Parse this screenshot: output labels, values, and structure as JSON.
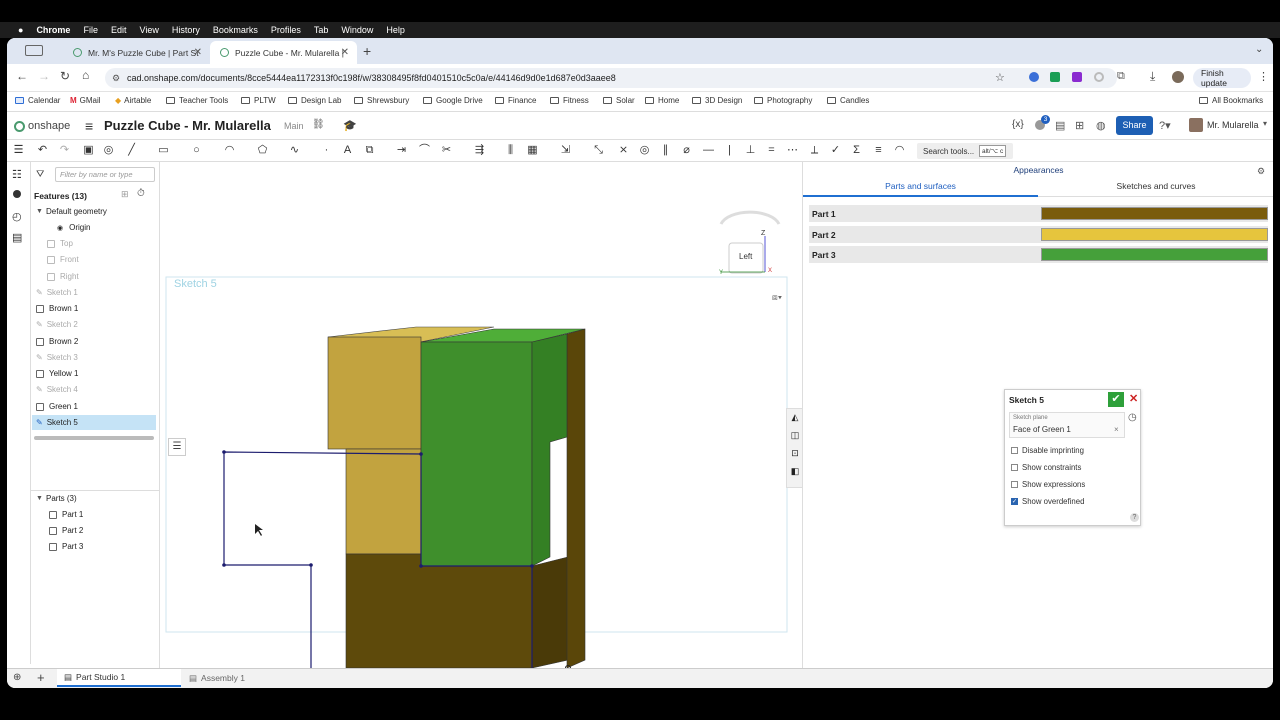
{
  "mac_menu": {
    "apple": "",
    "app": "Chrome",
    "items": [
      "File",
      "Edit",
      "View",
      "History",
      "Bookmarks",
      "Profiles",
      "Tab",
      "Window",
      "Help"
    ]
  },
  "tabs": [
    {
      "title": "Mr. M's Puzzle Cube | Part St"
    },
    {
      "title": "Puzzle Cube - Mr. Mularella |"
    }
  ],
  "address": {
    "url": "cad.onshape.com/documents/8cce5444ea1172313f0c198f/w/38308495f8fd0401510c5c0a/e/44146d9d0e1d687e0d3aaee8",
    "finish_update": "Finish update"
  },
  "bookmarks": [
    "Calendar",
    "GMail",
    "Airtable",
    "Teacher Tools",
    "PLTW",
    "Design Lab",
    "Shrewsbury",
    "Google Drive",
    "Finance",
    "Fitness",
    "Solar",
    "Home",
    "3D Design",
    "Photography",
    "Candles"
  ],
  "all_bookmarks": "All Bookmarks",
  "onshape": {
    "logo": "onshape",
    "doc_title": "Puzzle Cube - Mr. Mularella",
    "branch": "Main",
    "notif_count": "3",
    "share": "Share",
    "user": "Mr. Mularella",
    "search_tools": "Search tools...",
    "shortcut": "alt/⌥ c"
  },
  "features": {
    "filter_placeholder": "Filter by name or type",
    "header": "Features (13)",
    "default_geometry": "Default geometry",
    "items": [
      {
        "label": "Origin",
        "dim": false
      },
      {
        "label": "Top",
        "dim": true
      },
      {
        "label": "Front",
        "dim": true
      },
      {
        "label": "Right",
        "dim": true
      },
      {
        "label": "Sketch 1",
        "dim": true
      },
      {
        "label": "Brown 1",
        "dim": false
      },
      {
        "label": "Sketch 2",
        "dim": true
      },
      {
        "label": "Brown 2",
        "dim": false
      },
      {
        "label": "Sketch 3",
        "dim": true
      },
      {
        "label": "Yellow 1",
        "dim": false
      },
      {
        "label": "Sketch 4",
        "dim": true
      },
      {
        "label": "Green 1",
        "dim": false
      },
      {
        "label": "Sketch 5",
        "dim": false
      }
    ],
    "parts_header": "Parts (3)",
    "parts": [
      "Part 1",
      "Part 2",
      "Part 3"
    ]
  },
  "viewport": {
    "sketch_label": "Sketch 5",
    "view_cube": "Left",
    "axis_z": "Z",
    "axis_x": "X",
    "axis_y": "Y"
  },
  "appearances": {
    "title": "Appearances",
    "tab1": "Parts and surfaces",
    "tab2": "Sketches and curves",
    "parts": [
      {
        "name": "Part 1",
        "color": "#7a5c0c"
      },
      {
        "name": "Part 2",
        "color": "#e6c53d"
      },
      {
        "name": "Part 3",
        "color": "#45a03a"
      }
    ]
  },
  "sketch_dialog": {
    "title": "Sketch 5",
    "plane_label": "Sketch plane",
    "plane_value": "Face of Green 1",
    "options": [
      {
        "label": "Disable imprinting",
        "checked": false
      },
      {
        "label": "Show constraints",
        "checked": false
      },
      {
        "label": "Show expressions",
        "checked": false
      },
      {
        "label": "Show overdefined",
        "checked": true
      }
    ]
  },
  "bottom_tabs": [
    "Part Studio 1",
    "Assembly 1"
  ],
  "colors": {
    "accent": "#1f6fd1",
    "share_bg": "#1d5fb4",
    "selected_row": "#c5e3f6",
    "brown": "#5e4a0b",
    "yellow": "#c2a33f",
    "green": "#3f8f2c"
  }
}
